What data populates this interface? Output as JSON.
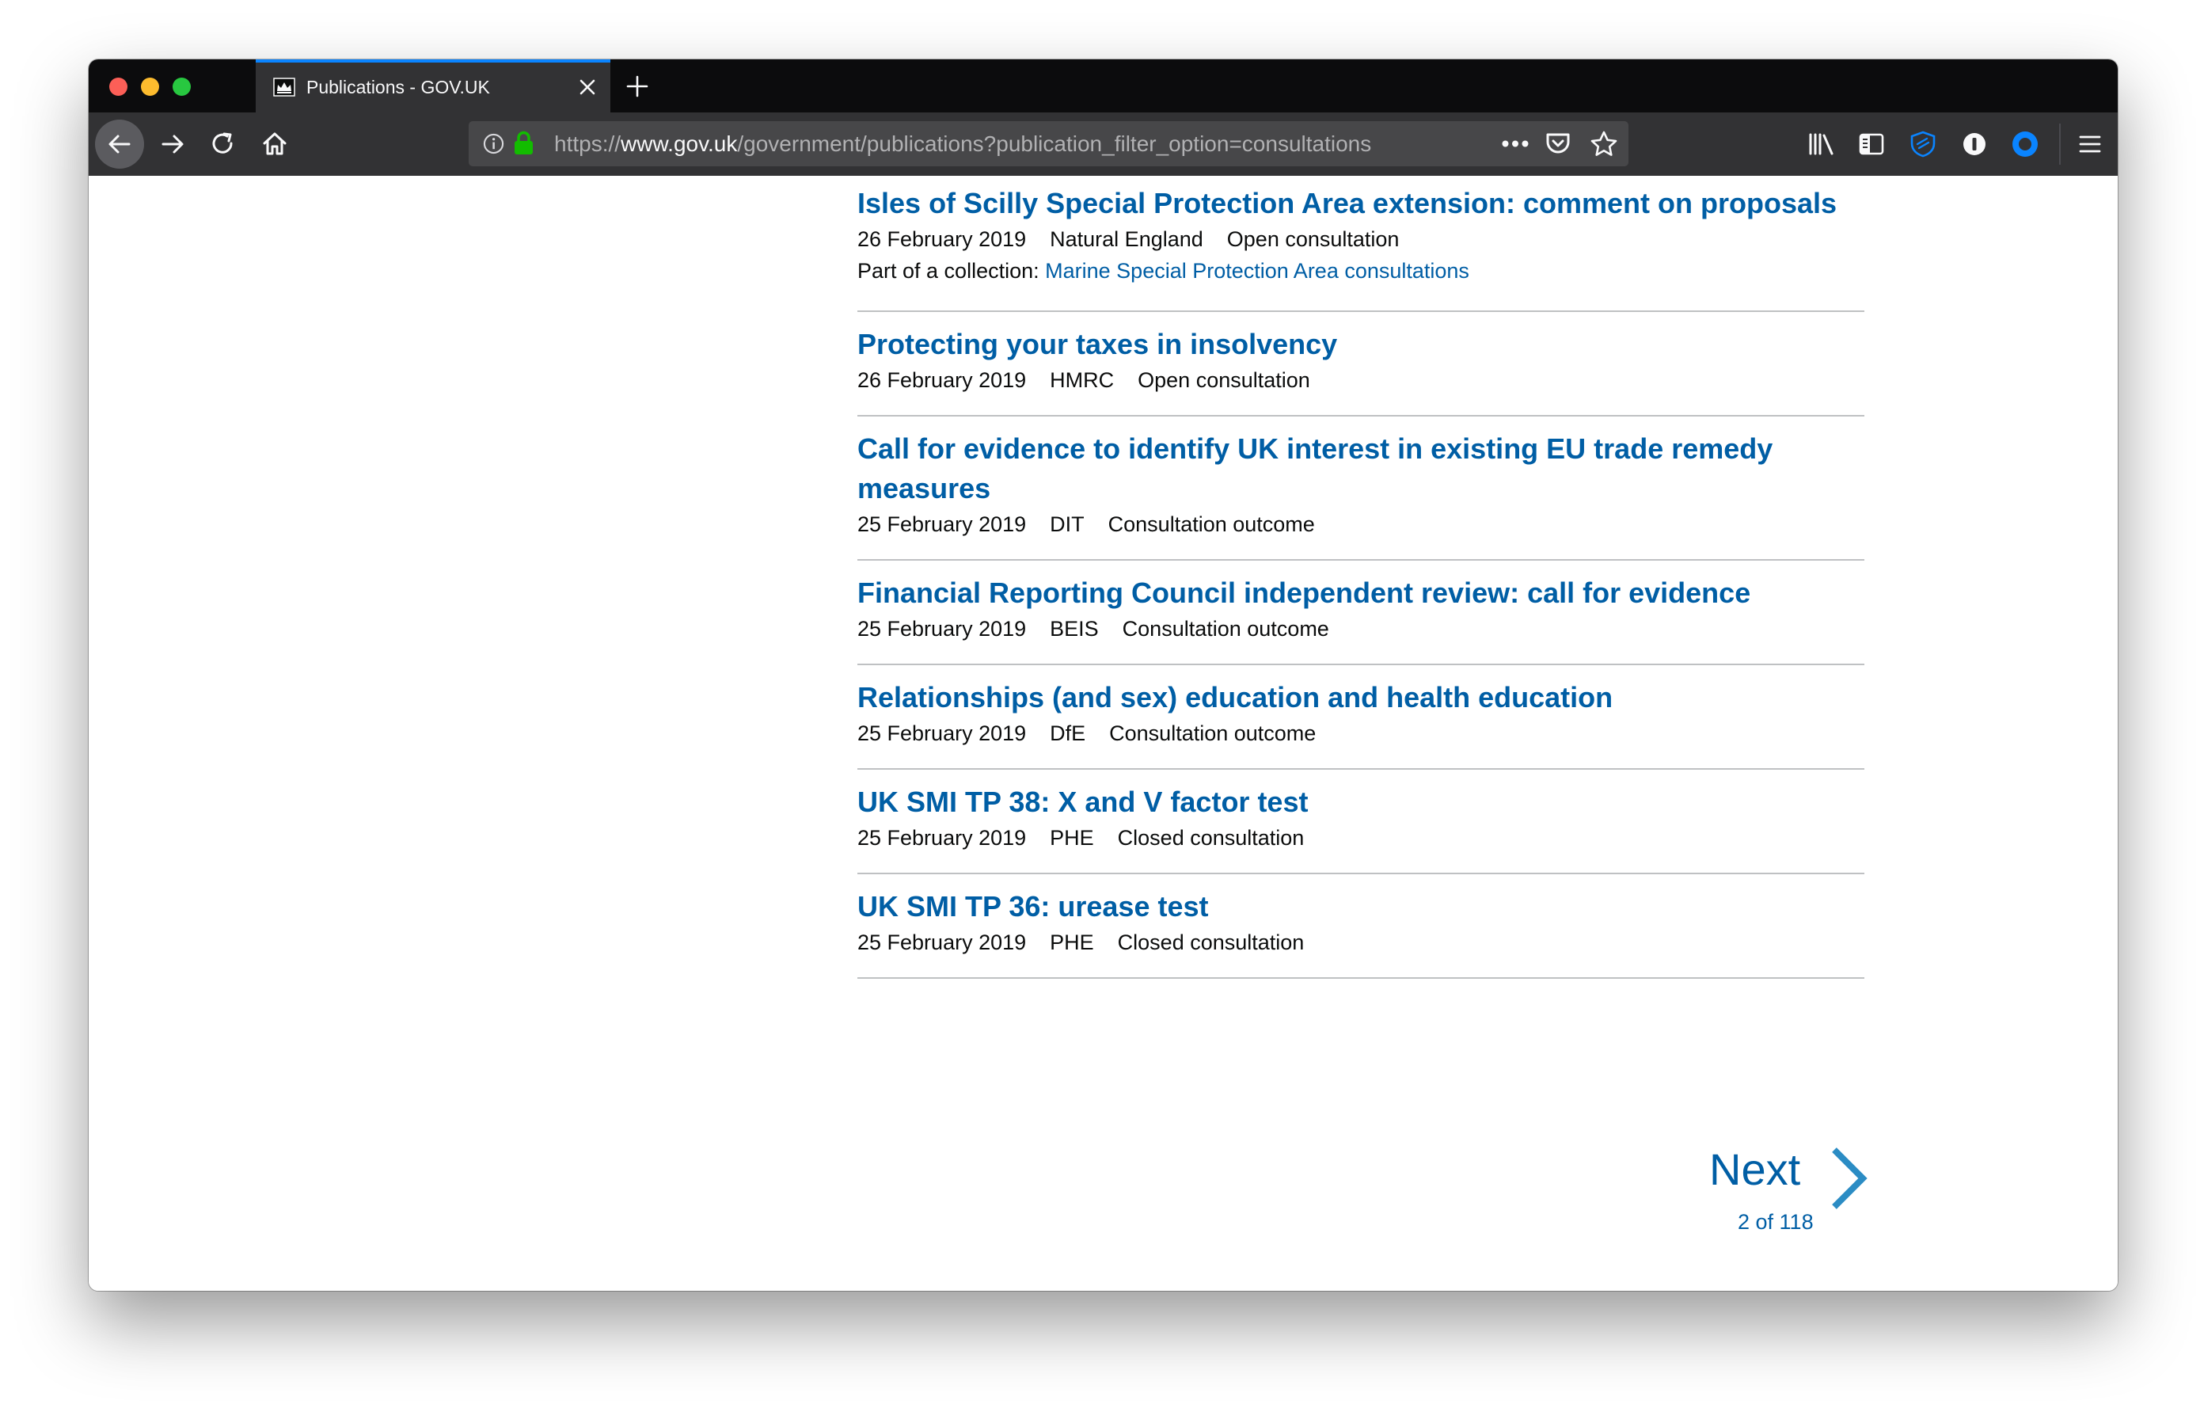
{
  "browser": {
    "tab_title": "Publications - GOV.UK",
    "url_prefix": "https://",
    "url_host": "www.gov.uk",
    "url_path": "/government/publications?publication_filter_option=consultations"
  },
  "results": [
    {
      "title": "Isles of Scilly Special Protection Area extension: comment on proposals",
      "date": "26 February 2019",
      "org": "Natural England",
      "type": "Open consultation",
      "collection_label": "Part of a collection:",
      "collection_link": "Marine Special Protection Area consultations"
    },
    {
      "title": "Protecting your taxes in insolvency",
      "date": "26 February 2019",
      "org": "HMRC",
      "type": "Open consultation"
    },
    {
      "title": "Call for evidence to identify UK interest in existing EU trade remedy measures",
      "date": "25 February 2019",
      "org": "DIT",
      "type": "Consultation outcome"
    },
    {
      "title": "Financial Reporting Council independent review: call for evidence",
      "date": "25 February 2019",
      "org": "BEIS",
      "type": "Consultation outcome"
    },
    {
      "title": "Relationships (and sex) education and health education",
      "date": "25 February 2019",
      "org": "DfE",
      "type": "Consultation outcome"
    },
    {
      "title": "UK SMI TP 38: X and V factor test",
      "date": "25 February 2019",
      "org": "PHE",
      "type": "Closed consultation"
    },
    {
      "title": "UK SMI TP 36: urease test",
      "date": "25 February 2019",
      "org": "PHE",
      "type": "Closed consultation"
    }
  ],
  "pagination": {
    "next_label": "Next",
    "page_info": "2 of 118"
  },
  "colors": {
    "link": "#005ea5",
    "text": "#0b0c0c",
    "divider": "#bfc1c3",
    "browser_dark": "#0c0c0d",
    "toolbar": "#323234"
  },
  "icons": [
    "crown-icon",
    "close-icon",
    "plus-icon",
    "back-arrow-icon",
    "forward-arrow-icon",
    "reload-icon",
    "home-icon",
    "info-icon",
    "lock-icon",
    "more-icon",
    "pocket-icon",
    "star-icon",
    "library-icon",
    "sidebar-icon",
    "shield-icon",
    "password-icon",
    "account-icon",
    "menu-icon",
    "chevron-right-icon"
  ]
}
